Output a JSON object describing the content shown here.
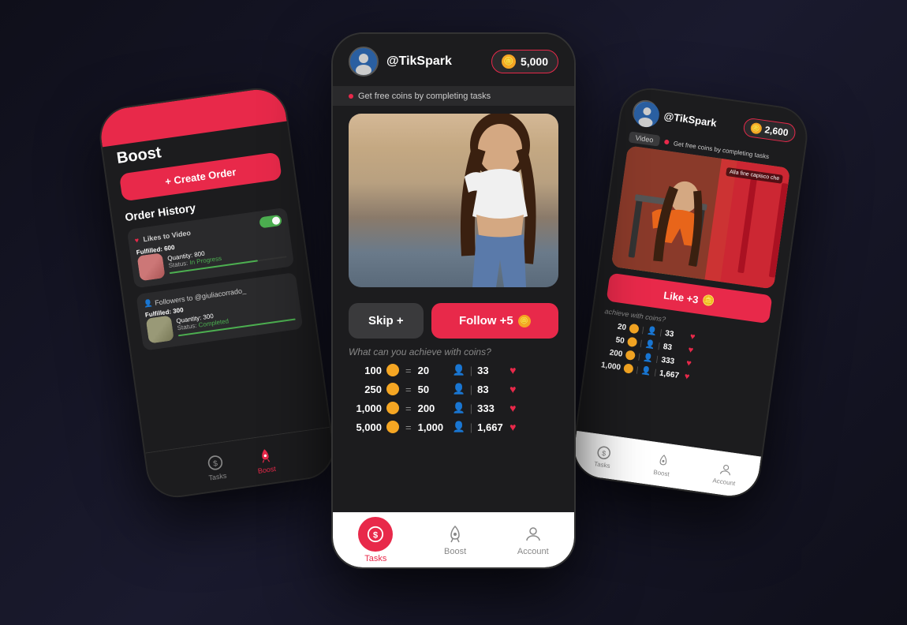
{
  "left_phone": {
    "red_bar": true,
    "title": "Boost",
    "create_btn": "+ Create Order",
    "order_history_title": "Order History",
    "orders": [
      {
        "label": "Likes to Video",
        "fulfilled_label": "Fulfilled:",
        "fulfilled_value": "600",
        "qty_label": "Quantity:",
        "qty_value": "800",
        "status_label": "Status:",
        "status_value": "In Progress",
        "status_class": "in-progress",
        "progress": 75
      },
      {
        "label": "Followers to @giuliacorrado_",
        "fulfilled_label": "Fulfilled:",
        "fulfilled_value": "300",
        "qty_label": "Quantity:",
        "qty_value": "300",
        "status_label": "Status:",
        "status_value": "Completed",
        "status_class": "completed",
        "progress": 100
      }
    ],
    "nav": [
      {
        "label": "Tasks",
        "active": false
      },
      {
        "label": "Boost",
        "active": true
      }
    ]
  },
  "center_phone": {
    "username": "@TikSpark",
    "coins": "5,000",
    "free_coins_text": "Get free coins by completing tasks",
    "skip_label": "Skip +",
    "follow_label": "Follow +5",
    "achieve_text": "What can you achieve with coins?",
    "table_rows": [
      {
        "coins": "100",
        "followers": "20",
        "likes": "33"
      },
      {
        "coins": "250",
        "followers": "50",
        "likes": "83"
      },
      {
        "coins": "1,000",
        "followers": "200",
        "likes": "333"
      },
      {
        "coins": "5,000",
        "followers": "1,000",
        "likes": "1,667"
      }
    ],
    "nav": [
      {
        "label": "Tasks",
        "active": true
      },
      {
        "label": "Boost",
        "active": false
      },
      {
        "label": "Account",
        "active": false
      }
    ]
  },
  "right_phone": {
    "username": "@TikSpark",
    "coins": "2,600",
    "video_label": "Video",
    "free_coins_text": "Get free coins by completing tasks",
    "video_caption": "Alla fine capisco che",
    "like_label": "Like +3",
    "achieve_text": "achieve with coins?",
    "table_rows": [
      {
        "coins": "20",
        "followers": "",
        "likes": "33"
      },
      {
        "coins": "50",
        "followers": "",
        "likes": "83"
      },
      {
        "coins": "200",
        "followers": "",
        "likes": "333"
      },
      {
        "coins": "1,000",
        "followers": "",
        "likes": "1,667"
      }
    ],
    "nav": [
      {
        "label": "Tasks",
        "active": false
      },
      {
        "label": "Boost",
        "active": false
      },
      {
        "label": "Account",
        "active": false
      }
    ]
  },
  "colors": {
    "accent": "#e8294a",
    "coin": "#f5a623",
    "bg_dark": "#1c1c1e",
    "bg_card": "#2a2a2c",
    "text_primary": "#ffffff",
    "text_secondary": "#aaaaaa",
    "success": "#4CAF50"
  }
}
